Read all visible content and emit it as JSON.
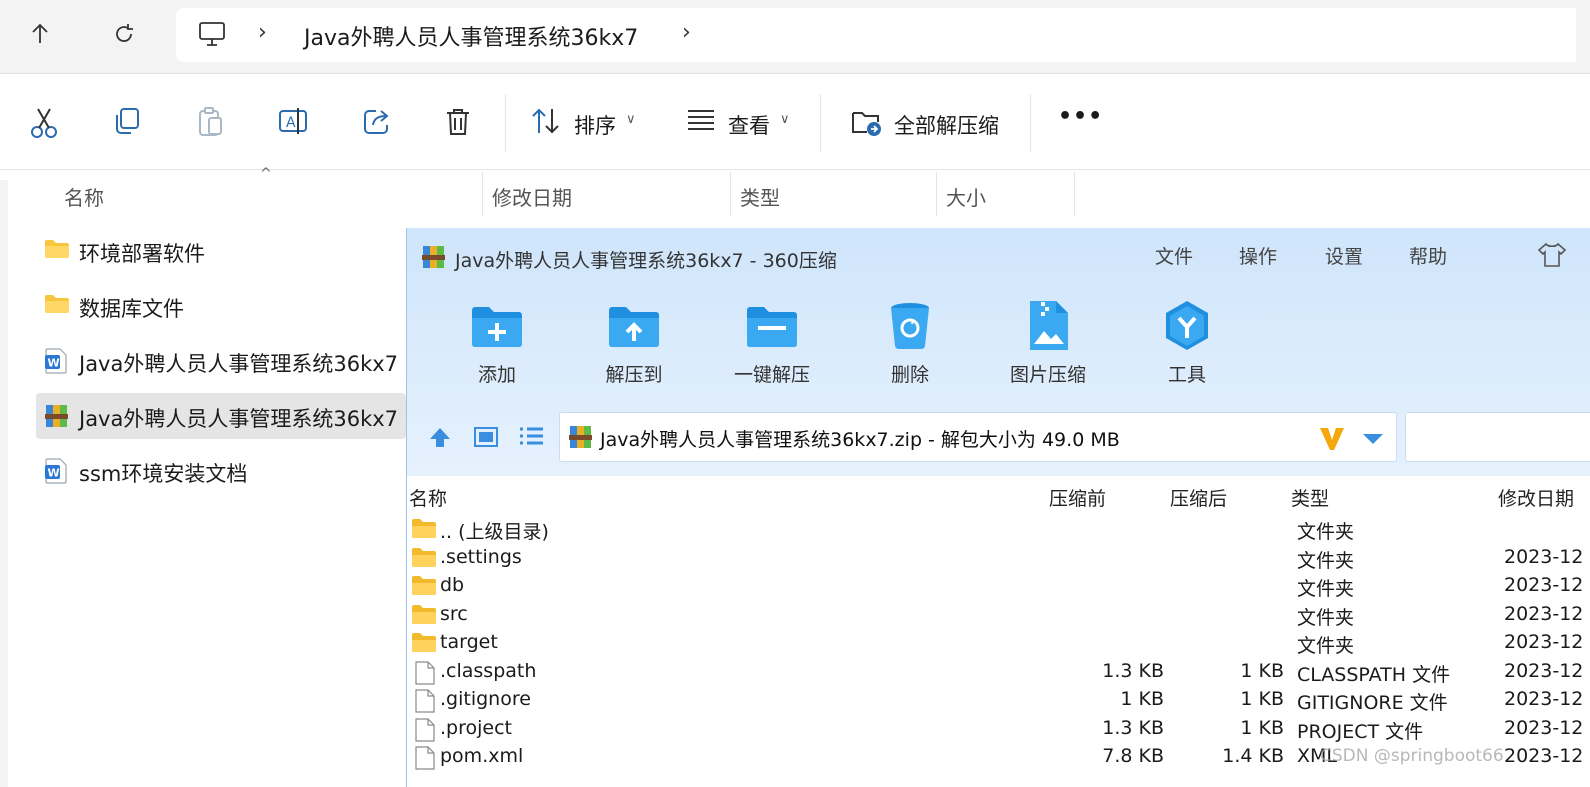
{
  "explorer": {
    "breadcrumb": "Java外聘人员人事管理系统36kx7",
    "toolbar": {
      "sort_label": "排序",
      "view_label": "查看",
      "extract_all_label": "全部解压缩",
      "more_label": "•••"
    },
    "columns": {
      "name": "名称",
      "modified": "修改日期",
      "type": "类型",
      "size": "大小"
    },
    "items": [
      {
        "label": "环境部署软件",
        "icon": "folder-icon"
      },
      {
        "label": "数据库文件",
        "icon": "folder-icon"
      },
      {
        "label": "Java外聘人员人事管理系统36kx7",
        "icon": "word-doc-icon"
      },
      {
        "label": "Java外聘人员人事管理系统36kx7",
        "icon": "zip-archive-icon",
        "selected": true
      },
      {
        "label": "ssm环境安装文档",
        "icon": "word-doc-icon"
      }
    ]
  },
  "archiver": {
    "title": "Java外聘人员人事管理系统36kx7 - 360压缩",
    "menu": [
      "文件",
      "操作",
      "设置",
      "帮助"
    ],
    "tools": [
      "添加",
      "解压到",
      "一键解压",
      "删除",
      "图片压缩",
      "工具"
    ],
    "path": "Java外聘人员人事管理系统36kx7.zip - 解包大小为 49.0 MB",
    "columns": {
      "name": "名称",
      "before": "压缩前",
      "after": "压缩后",
      "type": "类型",
      "modified": "修改日期"
    },
    "rows": [
      {
        "name": ".. (上级目录)",
        "before": "",
        "after": "",
        "type": "文件夹",
        "modified": "",
        "kind": "folder"
      },
      {
        "name": ".settings",
        "before": "",
        "after": "",
        "type": "文件夹",
        "modified": "2023-12",
        "kind": "folder"
      },
      {
        "name": "db",
        "before": "",
        "after": "",
        "type": "文件夹",
        "modified": "2023-12",
        "kind": "folder"
      },
      {
        "name": "src",
        "before": "",
        "after": "",
        "type": "文件夹",
        "modified": "2023-12",
        "kind": "folder"
      },
      {
        "name": "target",
        "before": "",
        "after": "",
        "type": "文件夹",
        "modified": "2023-12",
        "kind": "folder"
      },
      {
        "name": ".classpath",
        "before": "1.3 KB",
        "after": "1 KB",
        "type": "CLASSPATH 文件",
        "modified": "2023-12",
        "kind": "file"
      },
      {
        "name": ".gitignore",
        "before": "1 KB",
        "after": "1 KB",
        "type": "GITIGNORE 文件",
        "modified": "2023-12",
        "kind": "file"
      },
      {
        "name": ".project",
        "before": "1.3 KB",
        "after": "1 KB",
        "type": "PROJECT 文件",
        "modified": "2023-12",
        "kind": "file"
      },
      {
        "name": "pom.xml",
        "before": "7.8 KB",
        "after": "1.4 KB",
        "type": "XML",
        "modified": "2023-12",
        "kind": "file"
      }
    ]
  },
  "watermark": "CSDN @springboot66"
}
